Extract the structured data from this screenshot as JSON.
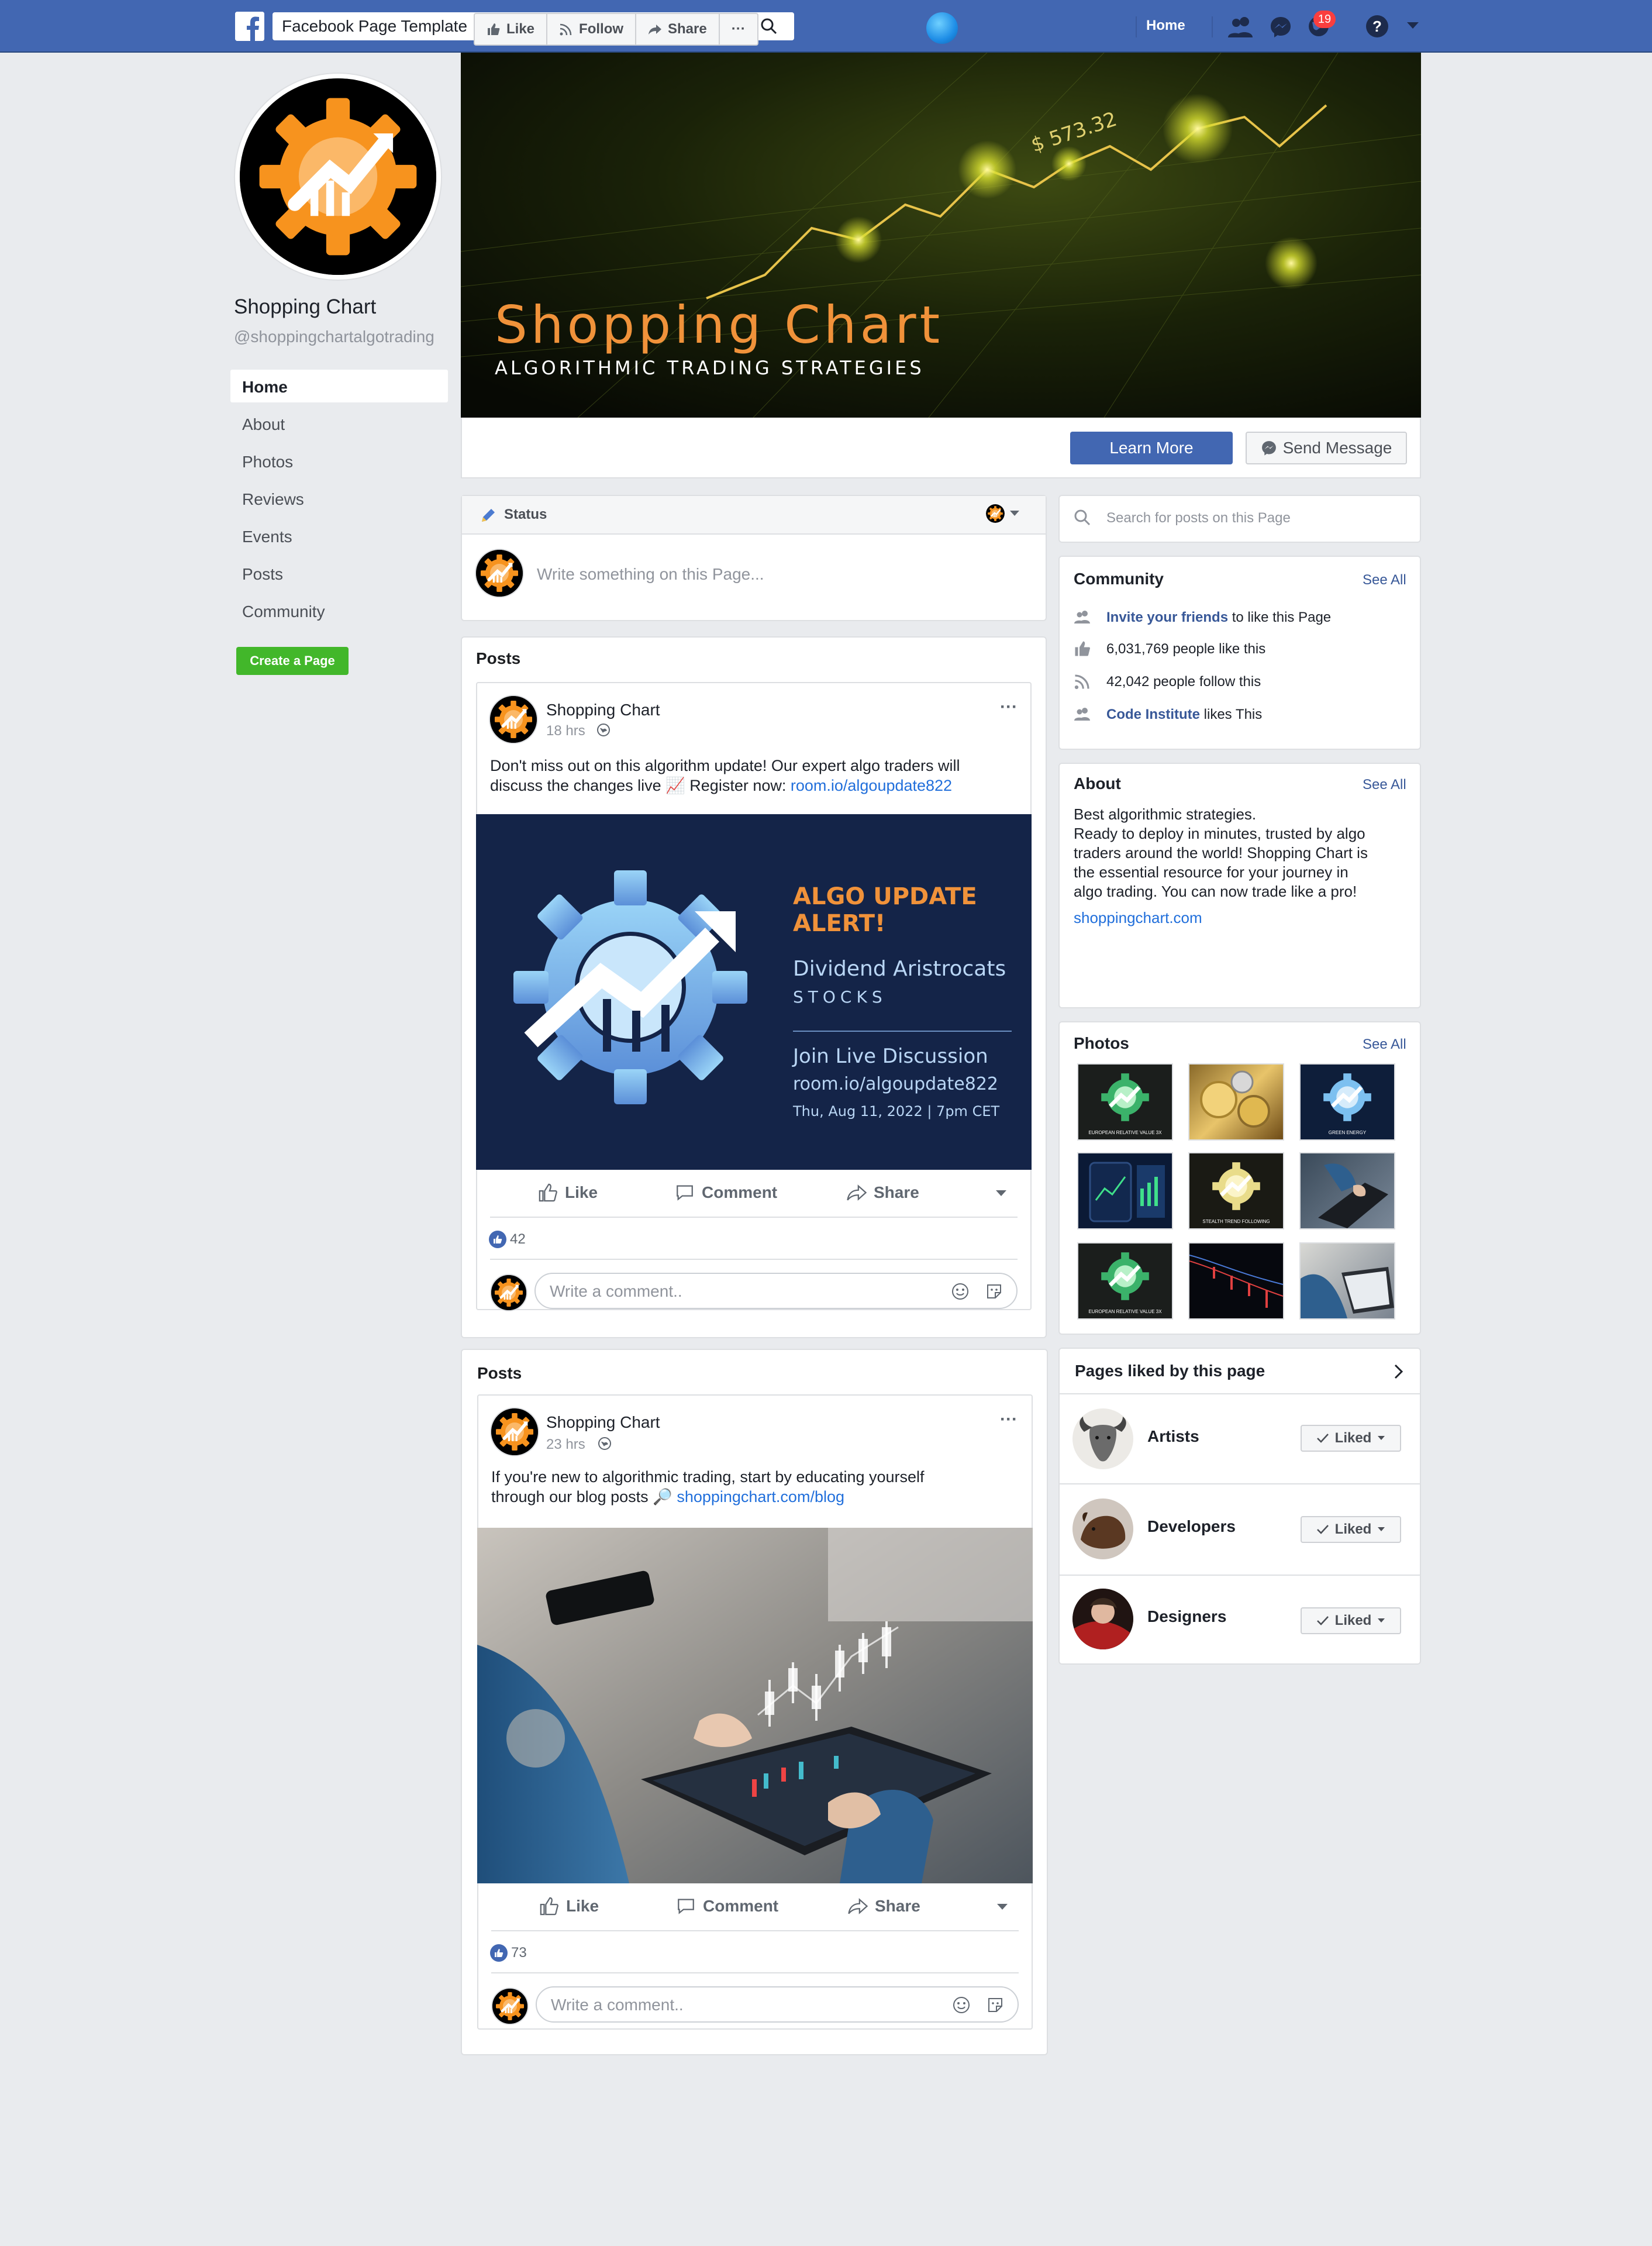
{
  "topbar": {
    "search_value": "Facebook Page Template",
    "home_label": "Home",
    "notification_count": "19"
  },
  "page": {
    "name": "Shopping Chart",
    "handle": "@shoppingchartalgotrading",
    "nav": [
      "Home",
      "About",
      "Photos",
      "Reviews",
      "Events",
      "Posts",
      "Community"
    ],
    "create_page_label": "Create a Page"
  },
  "cover": {
    "title": "Shopping Chart",
    "subtitle": "ALGORITHMIC TRADING STRATEGIES",
    "price_text": "$ 573.32"
  },
  "actions": {
    "like": "Like",
    "follow": "Follow",
    "share": "Share",
    "more": "···",
    "learn_more": "Learn More",
    "send_message": "Send Message"
  },
  "composer": {
    "status_label": "Status",
    "placeholder": "Write something on this Page..."
  },
  "posts": [
    {
      "section_title": "Posts",
      "author": "Shopping Chart",
      "time": "18 hrs",
      "text_line1": "Don't miss out on this algorithm update! Our expert algo traders will",
      "text_line2_pre": "discuss the changes live 📈 Register now: ",
      "link": "room.io/algoupdate822",
      "image": {
        "headline1": "ALGO UPDATE",
        "headline2": "ALERT!",
        "sub1": "Dividend Aristrocats",
        "sub2": "STOCKS",
        "join": "Join Live Discussion",
        "url": "room.io/algoupdate822",
        "date": "Thu, Aug 11, 2022 | 7pm CET"
      },
      "like_label": "Like",
      "comment_label": "Comment",
      "share_label": "Share",
      "likes_count": "42",
      "comment_placeholder": "Write a comment.."
    },
    {
      "section_title": "Posts",
      "author": "Shopping Chart",
      "time": "23 hrs",
      "text_line1": "If you're new to algorithmic trading, start by educating yourself",
      "text_line2_pre": "through our blog posts 🔎 ",
      "link": "shoppingchart.com/blog",
      "like_label": "Like",
      "comment_label": "Comment",
      "share_label": "Share",
      "likes_count": "73",
      "comment_placeholder": "Write a comment.."
    }
  ],
  "sidebar": {
    "search_placeholder": "Search for posts on this Page",
    "community": {
      "title": "Community",
      "see_all": "See All",
      "invite_link": "Invite your friends",
      "invite_rest": " to like this Page",
      "likes": "6,031,769 people like this",
      "follows": "42,042 people follow this",
      "ci_link": "Code Institute",
      "ci_rest": " likes This"
    },
    "about": {
      "title": "About",
      "see_all": "See All",
      "lines": [
        "Best algorithmic strategies.",
        "Ready to deploy in minutes, trusted by algo",
        "traders around the world! Shopping Chart is",
        "the essential resource for your journey in",
        "algo trading. You can now trade like a pro!"
      ],
      "website": "shoppingchart.com"
    },
    "photos": {
      "title": "Photos",
      "see_all": "See All",
      "captions": [
        "EUROPEAN RELATIVE VALUE 3X",
        "GREEN ENERGY",
        "STEALTH TREND FOLLOWING",
        "EUROPEAN RELATIVE VALUE 3X"
      ]
    },
    "pages_liked": {
      "title": "Pages liked by this page",
      "items": [
        {
          "name": "Artists",
          "button": "Liked"
        },
        {
          "name": "Developers",
          "button": "Liked"
        },
        {
          "name": "Designers",
          "button": "Liked"
        }
      ]
    }
  },
  "colors": {
    "topbar": "#4267b2",
    "accent_orange": "#f0923a",
    "link": "#216fdb",
    "create_green": "#42b72a"
  }
}
